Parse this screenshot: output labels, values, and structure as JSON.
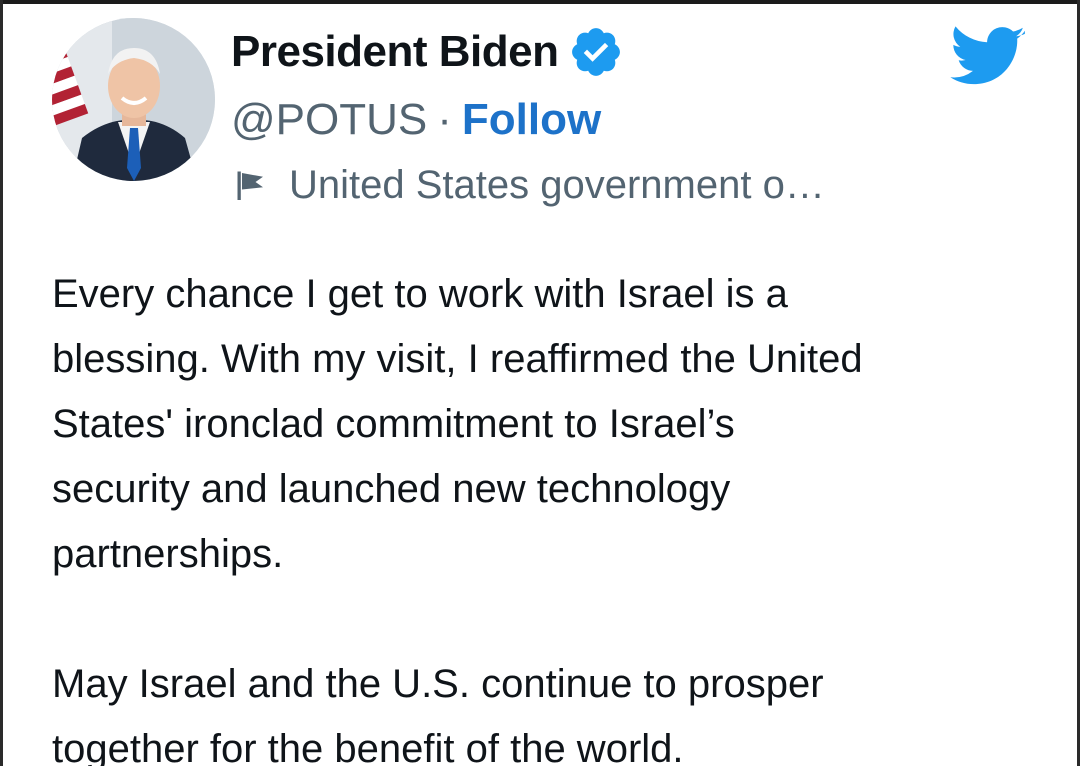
{
  "author": {
    "display_name": "President Biden",
    "handle": "@POTUS",
    "separator": "·",
    "follow_label": "Follow",
    "affiliation_label": "United States government o…",
    "verified": true
  },
  "icons": {
    "verified": "verified-badge-icon",
    "brand": "twitter-bird-icon",
    "label": "flag-icon"
  },
  "colors": {
    "brand_blue": "#1d9bf0",
    "link_blue": "#1d72c9",
    "secondary_text": "#536471",
    "primary_text": "#0f1419"
  },
  "tweet": {
    "lines": [
      "Every chance I get to work with Israel is a",
      "blessing. With my visit, I reaffirmed the United",
      "States' ironclad commitment to Israel’s",
      "security and launched new technology",
      "partnerships.",
      "",
      "May Israel and the U.S. continue to prosper",
      "together for the benefit of the world."
    ]
  }
}
